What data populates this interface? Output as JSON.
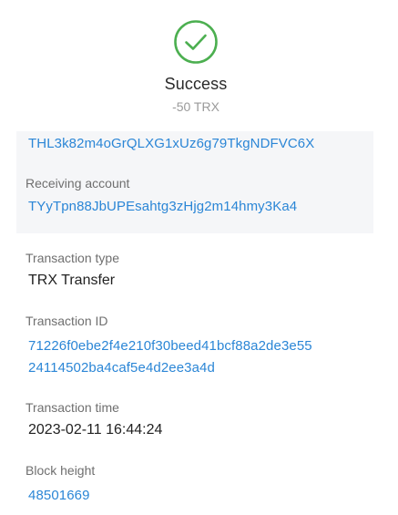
{
  "status": {
    "icon": "check-circle-icon",
    "color": "#4caf50",
    "title": "Success",
    "amount": "-50 TRX"
  },
  "accounts": {
    "sending_address": "THL3k82m4oGrQLXG1xUz6g79TkgNDFVC6X",
    "receiving_label": "Receiving account",
    "receiving_address": "TYyTpn88JbUPEsahtg3zHjg2m14hmy3Ka4"
  },
  "details": {
    "type_label": "Transaction type",
    "type_value": "TRX Transfer",
    "id_label": "Transaction ID",
    "id_line1": "71226f0ebe2f4e210f30beed41bcf88a2de3e55",
    "id_line2": "24114502ba4caf5e4d2ee3a4d",
    "time_label": "Transaction time",
    "time_value": "2023-02-11 16:44:24",
    "block_label": "Block height",
    "block_value": "48501669"
  },
  "colors": {
    "link": "#2b86d6",
    "label": "#6f6f6f",
    "panel": "#f5f6f8"
  }
}
